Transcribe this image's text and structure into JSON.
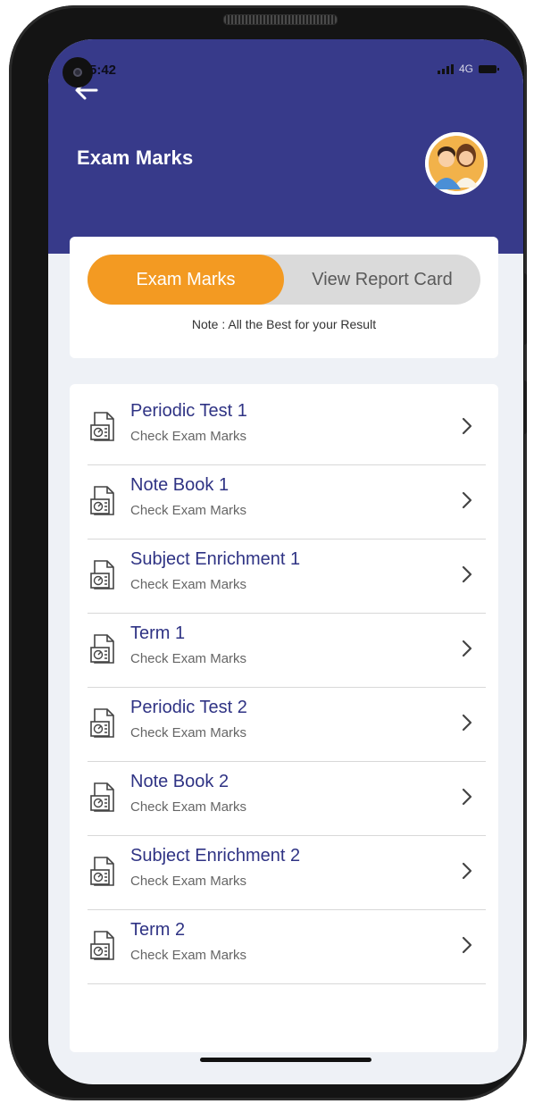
{
  "status_bar": {
    "time": "5:42",
    "network": "4G"
  },
  "header": {
    "title": "Exam Marks",
    "color": "#373a8a"
  },
  "tabs": {
    "active_label": "Exam Marks",
    "inactive_label": "View Report Card",
    "active_color": "#f39a22"
  },
  "note": "Note : All the Best for your Result",
  "exams": [
    {
      "title": "Periodic Test 1",
      "subtitle": "Check Exam Marks"
    },
    {
      "title": "Note Book 1",
      "subtitle": "Check Exam Marks"
    },
    {
      "title": "Subject Enrichment 1",
      "subtitle": "Check Exam Marks"
    },
    {
      "title": "Term 1",
      "subtitle": "Check Exam Marks"
    },
    {
      "title": "Periodic Test 2",
      "subtitle": "Check Exam Marks"
    },
    {
      "title": "Note Book 2",
      "subtitle": "Check Exam Marks"
    },
    {
      "title": "Subject Enrichment 2",
      "subtitle": "Check Exam Marks"
    },
    {
      "title": "Term 2",
      "subtitle": "Check Exam Marks"
    }
  ],
  "icons": {
    "back": "back-arrow-icon",
    "avatar": "parents-avatar",
    "row_icon": "exam-document-icon",
    "row_arrow": "chevron-right-icon"
  }
}
